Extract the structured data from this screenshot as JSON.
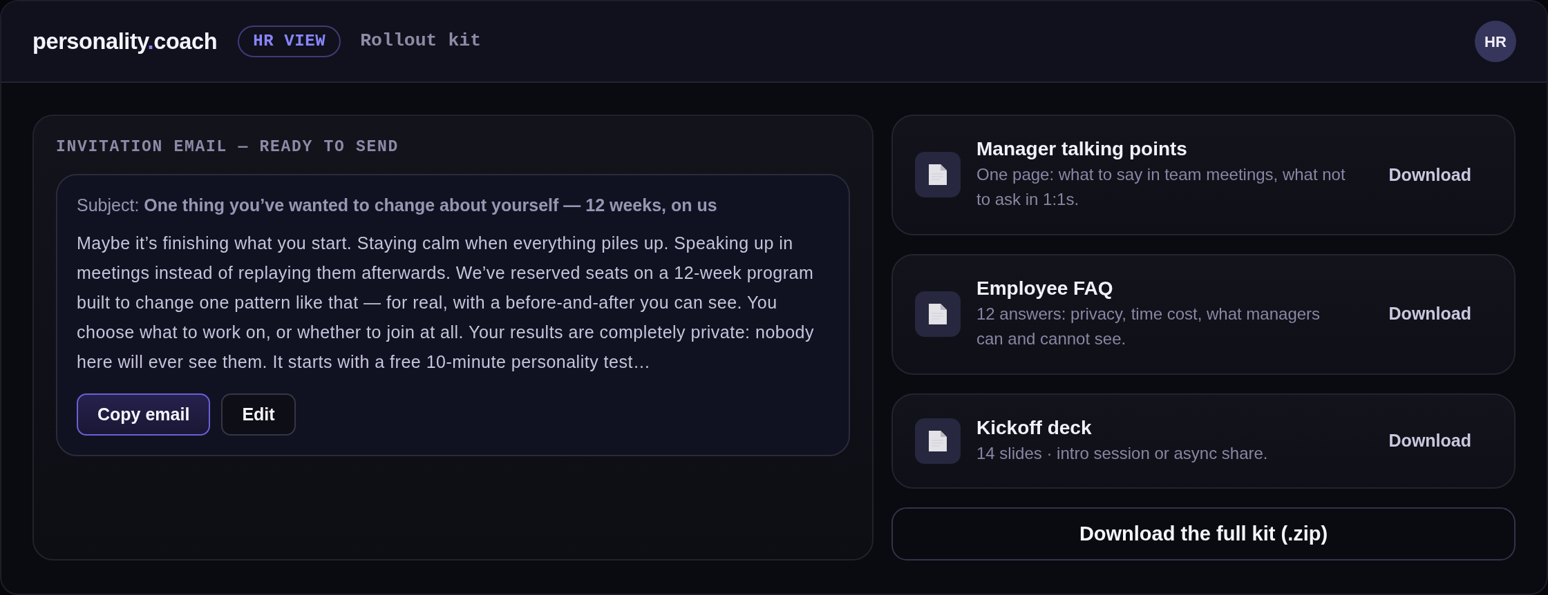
{
  "header": {
    "logo": {
      "text_before": "personality",
      "accent_text": ".",
      "text_after": "coach"
    },
    "badge": "HR VIEW",
    "page_title": "Rollout kit",
    "avatar": "HR"
  },
  "email_panel": {
    "heading": "INVITATION EMAIL — READY TO SEND",
    "subject": "Subject: **One thing you’ve wanted to change about yourself — 12 weeks, on us**",
    "body": "Maybe it’s finishing what you start. Staying calm when everything piles up. Speaking up in meetings instead of replaying them afterwards. We’ve reserved seats on a 12-week program built to change one pattern like that — for real, with a before-and-after you can see. You choose what to work on, or whether to join at all. Your results are completely private: nobody here will ever see them. It starts with a free 10-minute personality test…",
    "buttons": [
      {
        "label": "Copy email",
        "kind": "primary"
      },
      {
        "label": "Edit",
        "kind": "secondary"
      }
    ]
  },
  "resources": [
    {
      "title": "Manager talking points",
      "description": "One page: what to say in team meetings, what not to ask in 1:1s.",
      "action": "Download"
    },
    {
      "title": "Employee FAQ",
      "description": "12 answers: privacy, time cost, what managers can and cannot see.",
      "action": "Download"
    },
    {
      "title": "Kickoff deck",
      "description": "14 slides · intro session or async share.",
      "action": "Download"
    }
  ],
  "full_kit_button": "Download the full kit (.zip)"
}
